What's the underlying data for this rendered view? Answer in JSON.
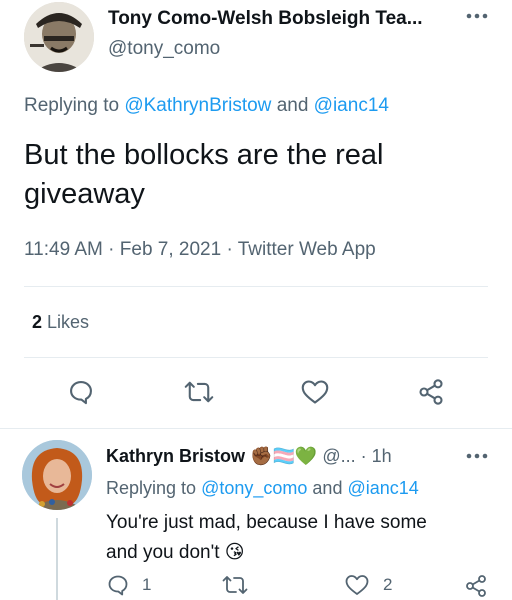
{
  "tweet": {
    "author_name": "Tony Como-Welsh Bobsleigh Tea...",
    "author_handle": "@tony_como",
    "replying_prefix": "Replying to",
    "replying_users": [
      "@KathrynBristow",
      "@ianc14"
    ],
    "replying_and": "and",
    "text_line1": "But the bollocks are the real",
    "text_line2": "giveaway",
    "time": "11:49 AM",
    "date": "Feb 7, 2021",
    "source": "Twitter Web App",
    "likes_count": "2",
    "likes_label": "Likes",
    "icons": [
      "reply-icon",
      "retweet-icon",
      "like-icon",
      "share-icon"
    ]
  },
  "reply": {
    "author_name": "Kathryn Bristow",
    "author_emoji": "✊🏾🏳️‍⚧️💚",
    "author_handle": "@...",
    "time": "· 1h",
    "replying_prefix": "Replying to",
    "replying_users": [
      "@tony_como",
      "@ianc14"
    ],
    "replying_and": "and",
    "text_line1": "You're just mad, because I have some",
    "text_line2": "and you don't 😘",
    "reply_count": "1",
    "like_count": "2"
  },
  "colors": {
    "accent": "#1d9bf0",
    "muted": "#536471",
    "text": "#0f1419"
  }
}
